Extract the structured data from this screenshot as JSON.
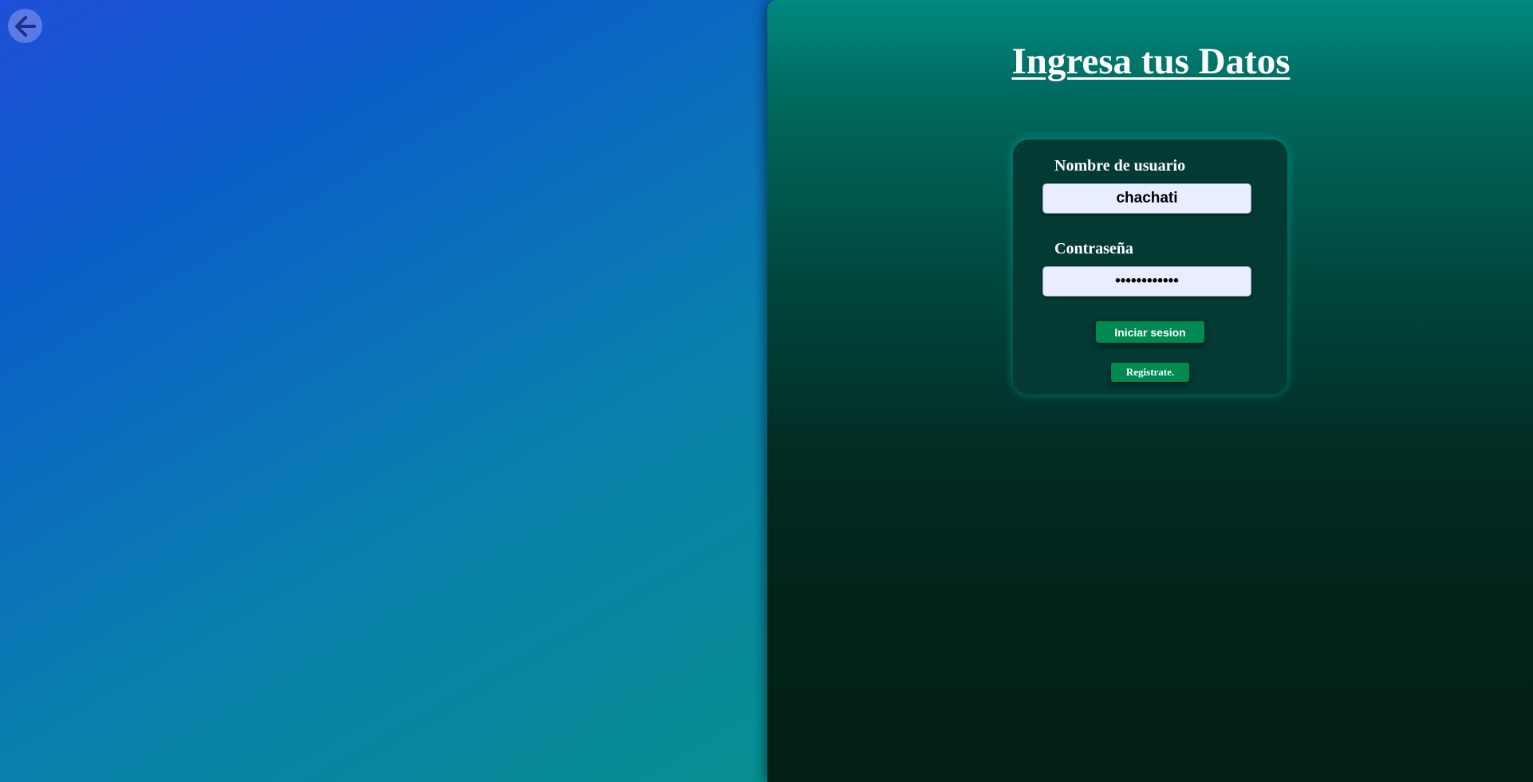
{
  "header": {
    "back_icon": "arrow-left-icon",
    "back_button_color": "#5a7be6"
  },
  "login": {
    "title": "Ingresa tus Datos",
    "username_label": "Nombre de usuario",
    "username_value": "chachati",
    "password_label": "Contraseña",
    "password_value": "chachati1234",
    "login_button": "Iniciar sesion",
    "register_button": "Registrate."
  },
  "colors": {
    "button_green": "#008a52",
    "card_bg": "#033a34",
    "input_bg": "#e8eefe"
  }
}
